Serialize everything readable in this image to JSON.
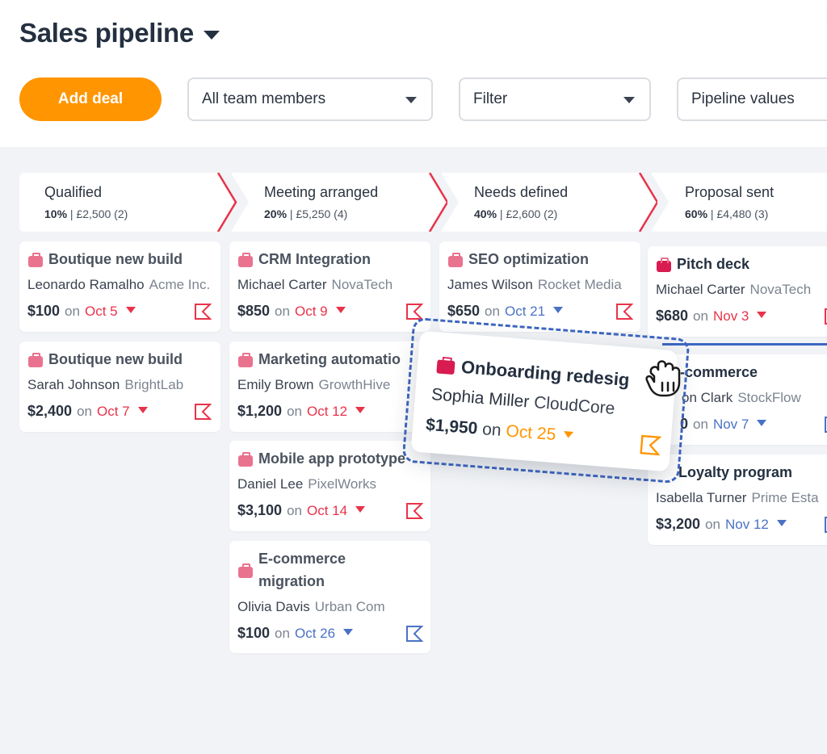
{
  "header": {
    "title": "Sales pipeline",
    "add_deal_label": "Add deal",
    "team_select": "All team members",
    "filter_select": "Filter",
    "pipeline_select": "Pipeline values"
  },
  "stages": [
    {
      "name": "Qualified",
      "percent": "10%",
      "summary": "| £2,500 (2)"
    },
    {
      "name": "Meeting arranged",
      "percent": "20%",
      "summary": "| £5,250 (4)"
    },
    {
      "name": "Needs defined",
      "percent": "40%",
      "summary": "| £2,600 (2)"
    },
    {
      "name": "Proposal sent",
      "percent": "60%",
      "summary": "| £4,480 (3)"
    }
  ],
  "cards": {
    "c1": {
      "title": "Boutique new build",
      "person": "Leonardo Ramalho",
      "org": "Acme Inc.",
      "amount": "$100",
      "on": "on",
      "date": "Oct 5"
    },
    "c2": {
      "title": "Boutique new build",
      "person": "Sarah Johnson",
      "org": "BrightLab",
      "amount": "$2,400",
      "on": "on",
      "date": "Oct 7"
    },
    "c3": {
      "title": "CRM Integration",
      "person": "Michael Carter",
      "org": "NovaTech",
      "amount": "$850",
      "on": "on",
      "date": "Oct 9"
    },
    "c4": {
      "title": "Marketing automatio",
      "person": "Emily Brown",
      "org": "GrowthHive",
      "amount": "$1,200",
      "on": "on",
      "date": "Oct 12"
    },
    "c5": {
      "title": "Mobile app prototype",
      "person": "Daniel Lee",
      "org": "PixelWorks",
      "amount": "$3,100",
      "on": "on",
      "date": "Oct 14"
    },
    "c6": {
      "title_line1": "E-commerce",
      "title_line2": "migration",
      "person": "Olivia Davis",
      "org": "Urban Com",
      "amount": "$100",
      "on": "on",
      "date": "Oct 26"
    },
    "c7": {
      "title": "SEO optimization",
      "person": "James Wilson",
      "org": "Rocket Media",
      "amount": "$650",
      "on": "on",
      "date": "Oct 21"
    },
    "c8": {
      "title": "Pitch deck",
      "person": "Michael Carter",
      "org": "NovaTech",
      "amount": "$680",
      "on": "on",
      "date": "Nov 3"
    },
    "c9": {
      "title": "-commerce",
      "person": "on Clark",
      "org": "StockFlow",
      "amount": "0",
      "on": "on",
      "date": "Nov 7"
    },
    "c10": {
      "title": "Loyalty program",
      "person": "Isabella Turner",
      "org": "Prime Esta",
      "amount": "$3,200",
      "on": "on",
      "date": "Nov 12"
    }
  },
  "drag_card": {
    "title": "Onboarding redesig",
    "person": "Sophia Miller",
    "org": "CloudCore",
    "amount": "$1,950",
    "on": "on",
    "date": "Oct 25"
  },
  "colors": {
    "accent": "#ff9500",
    "overdue": "#e8334a",
    "upcoming": "#4a72c4",
    "drag_outline": "#3d66c0",
    "deal_icon": "#e9738f"
  },
  "icons": [
    "chevron-down-icon",
    "briefcase-icon",
    "flag-icon",
    "grab-hand-cursor-icon"
  ]
}
